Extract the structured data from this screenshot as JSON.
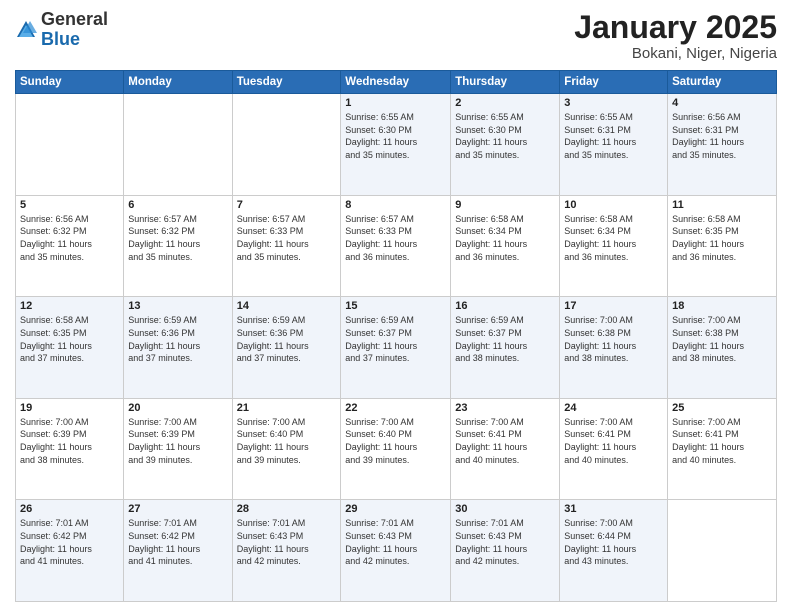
{
  "header": {
    "logo_general": "General",
    "logo_blue": "Blue",
    "title": "January 2025",
    "location": "Bokani, Niger, Nigeria"
  },
  "days_of_week": [
    "Sunday",
    "Monday",
    "Tuesday",
    "Wednesday",
    "Thursday",
    "Friday",
    "Saturday"
  ],
  "weeks": [
    [
      {
        "day": "",
        "text": ""
      },
      {
        "day": "",
        "text": ""
      },
      {
        "day": "",
        "text": ""
      },
      {
        "day": "1",
        "text": "Sunrise: 6:55 AM\nSunset: 6:30 PM\nDaylight: 11 hours\nand 35 minutes."
      },
      {
        "day": "2",
        "text": "Sunrise: 6:55 AM\nSunset: 6:30 PM\nDaylight: 11 hours\nand 35 minutes."
      },
      {
        "day": "3",
        "text": "Sunrise: 6:55 AM\nSunset: 6:31 PM\nDaylight: 11 hours\nand 35 minutes."
      },
      {
        "day": "4",
        "text": "Sunrise: 6:56 AM\nSunset: 6:31 PM\nDaylight: 11 hours\nand 35 minutes."
      }
    ],
    [
      {
        "day": "5",
        "text": "Sunrise: 6:56 AM\nSunset: 6:32 PM\nDaylight: 11 hours\nand 35 minutes."
      },
      {
        "day": "6",
        "text": "Sunrise: 6:57 AM\nSunset: 6:32 PM\nDaylight: 11 hours\nand 35 minutes."
      },
      {
        "day": "7",
        "text": "Sunrise: 6:57 AM\nSunset: 6:33 PM\nDaylight: 11 hours\nand 35 minutes."
      },
      {
        "day": "8",
        "text": "Sunrise: 6:57 AM\nSunset: 6:33 PM\nDaylight: 11 hours\nand 36 minutes."
      },
      {
        "day": "9",
        "text": "Sunrise: 6:58 AM\nSunset: 6:34 PM\nDaylight: 11 hours\nand 36 minutes."
      },
      {
        "day": "10",
        "text": "Sunrise: 6:58 AM\nSunset: 6:34 PM\nDaylight: 11 hours\nand 36 minutes."
      },
      {
        "day": "11",
        "text": "Sunrise: 6:58 AM\nSunset: 6:35 PM\nDaylight: 11 hours\nand 36 minutes."
      }
    ],
    [
      {
        "day": "12",
        "text": "Sunrise: 6:58 AM\nSunset: 6:35 PM\nDaylight: 11 hours\nand 37 minutes."
      },
      {
        "day": "13",
        "text": "Sunrise: 6:59 AM\nSunset: 6:36 PM\nDaylight: 11 hours\nand 37 minutes."
      },
      {
        "day": "14",
        "text": "Sunrise: 6:59 AM\nSunset: 6:36 PM\nDaylight: 11 hours\nand 37 minutes."
      },
      {
        "day": "15",
        "text": "Sunrise: 6:59 AM\nSunset: 6:37 PM\nDaylight: 11 hours\nand 37 minutes."
      },
      {
        "day": "16",
        "text": "Sunrise: 6:59 AM\nSunset: 6:37 PM\nDaylight: 11 hours\nand 38 minutes."
      },
      {
        "day": "17",
        "text": "Sunrise: 7:00 AM\nSunset: 6:38 PM\nDaylight: 11 hours\nand 38 minutes."
      },
      {
        "day": "18",
        "text": "Sunrise: 7:00 AM\nSunset: 6:38 PM\nDaylight: 11 hours\nand 38 minutes."
      }
    ],
    [
      {
        "day": "19",
        "text": "Sunrise: 7:00 AM\nSunset: 6:39 PM\nDaylight: 11 hours\nand 38 minutes."
      },
      {
        "day": "20",
        "text": "Sunrise: 7:00 AM\nSunset: 6:39 PM\nDaylight: 11 hours\nand 39 minutes."
      },
      {
        "day": "21",
        "text": "Sunrise: 7:00 AM\nSunset: 6:40 PM\nDaylight: 11 hours\nand 39 minutes."
      },
      {
        "day": "22",
        "text": "Sunrise: 7:00 AM\nSunset: 6:40 PM\nDaylight: 11 hours\nand 39 minutes."
      },
      {
        "day": "23",
        "text": "Sunrise: 7:00 AM\nSunset: 6:41 PM\nDaylight: 11 hours\nand 40 minutes."
      },
      {
        "day": "24",
        "text": "Sunrise: 7:00 AM\nSunset: 6:41 PM\nDaylight: 11 hours\nand 40 minutes."
      },
      {
        "day": "25",
        "text": "Sunrise: 7:00 AM\nSunset: 6:41 PM\nDaylight: 11 hours\nand 40 minutes."
      }
    ],
    [
      {
        "day": "26",
        "text": "Sunrise: 7:01 AM\nSunset: 6:42 PM\nDaylight: 11 hours\nand 41 minutes."
      },
      {
        "day": "27",
        "text": "Sunrise: 7:01 AM\nSunset: 6:42 PM\nDaylight: 11 hours\nand 41 minutes."
      },
      {
        "day": "28",
        "text": "Sunrise: 7:01 AM\nSunset: 6:43 PM\nDaylight: 11 hours\nand 42 minutes."
      },
      {
        "day": "29",
        "text": "Sunrise: 7:01 AM\nSunset: 6:43 PM\nDaylight: 11 hours\nand 42 minutes."
      },
      {
        "day": "30",
        "text": "Sunrise: 7:01 AM\nSunset: 6:43 PM\nDaylight: 11 hours\nand 42 minutes."
      },
      {
        "day": "31",
        "text": "Sunrise: 7:00 AM\nSunset: 6:44 PM\nDaylight: 11 hours\nand 43 minutes."
      },
      {
        "day": "",
        "text": ""
      }
    ]
  ]
}
